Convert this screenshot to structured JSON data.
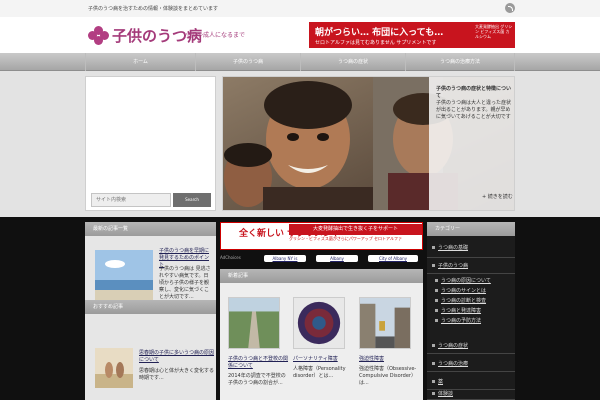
{
  "topbar": {
    "tagline": "子供のうつ病を治すための情報・体験談をまとめています",
    "rss_icon": "rss-icon"
  },
  "header": {
    "logo_title": "子供のうつ病",
    "logo_subtitle": "小児〜成人になるまで",
    "logo_icon": "flower-logo-icon",
    "ad": {
      "headline": "朝がつらい… 布団に入っても…",
      "subline": "セロトアルファは見てむありません サプリメントです",
      "side_text": "大麦発酵抽出 グリシン ビフィズス菌 カルシウム"
    }
  },
  "nav": {
    "items": [
      "ホーム",
      "子供のうつ病",
      "うつ病の症状",
      "うつ病の治療方法"
    ]
  },
  "search": {
    "placeholder": "サイト内検索",
    "button_label": "Search"
  },
  "slider": {
    "caption_title": "子供のうつ病の症状と特徴について",
    "caption_text": "子供のうつ病は大人と違った症状が出ることがあります。親が早めに気づいてあげることが大切です",
    "read_more": "+ 続きを読む"
  },
  "left_column": {
    "heading_1": "最新の記事一覧",
    "item_1_title": "子供のうつ病を早期に発見するためのポイント",
    "item_1_text": "子供のうつ病は 見逃されやすい病気です。日頃から子供の様子を観察し、変化に気づくことが大切です...",
    "heading_2": "おすすめ記事",
    "item_2_title": "思春期の子供に多いうつ病の原因について",
    "item_2_text": "思春期は心と体が大きく変化する時期です..."
  },
  "center_column": {
    "ad": {
      "big_text": "全く新しい サプリメント",
      "red_bar": "大麦発酵抽出で生き抜く子をサポート",
      "line": "グリシン・ビフィズス菌がさらにパワーアップ セロトアルファ"
    },
    "adchoices": "AdChoices",
    "ad_links": [
      "Albany NY is",
      "Albany",
      "City of Albany"
    ],
    "section_heading": "新着記事",
    "cards": [
      {
        "title": "子供のうつ病と不登校の関係について",
        "text": "2014年の調査で不登校の子供のうつ病の割合が..."
      },
      {
        "title": "パーソナリティ障害",
        "text": "人格障害（Personality disorder）とは..."
      },
      {
        "title": "強迫性障害",
        "text": "強迫性障害（Obsessive-Compulsive Disorder）は..."
      }
    ]
  },
  "right_column": {
    "heading": "カテゴリー",
    "categories": [
      "うつ病の基礎",
      "子供のうつ病",
      "うつ病の症状",
      "うつ病の治療",
      "薬",
      "体験談"
    ],
    "subcategories": [
      "うつ病の原因について",
      "うつ病のサインとは",
      "うつ病の診断と検査",
      "うつ病と発達障害",
      "うつ病の予防方法"
    ]
  },
  "colors": {
    "brand": "#a43a7a",
    "ad_red": "#c8141e",
    "dark_band": "#101010"
  }
}
